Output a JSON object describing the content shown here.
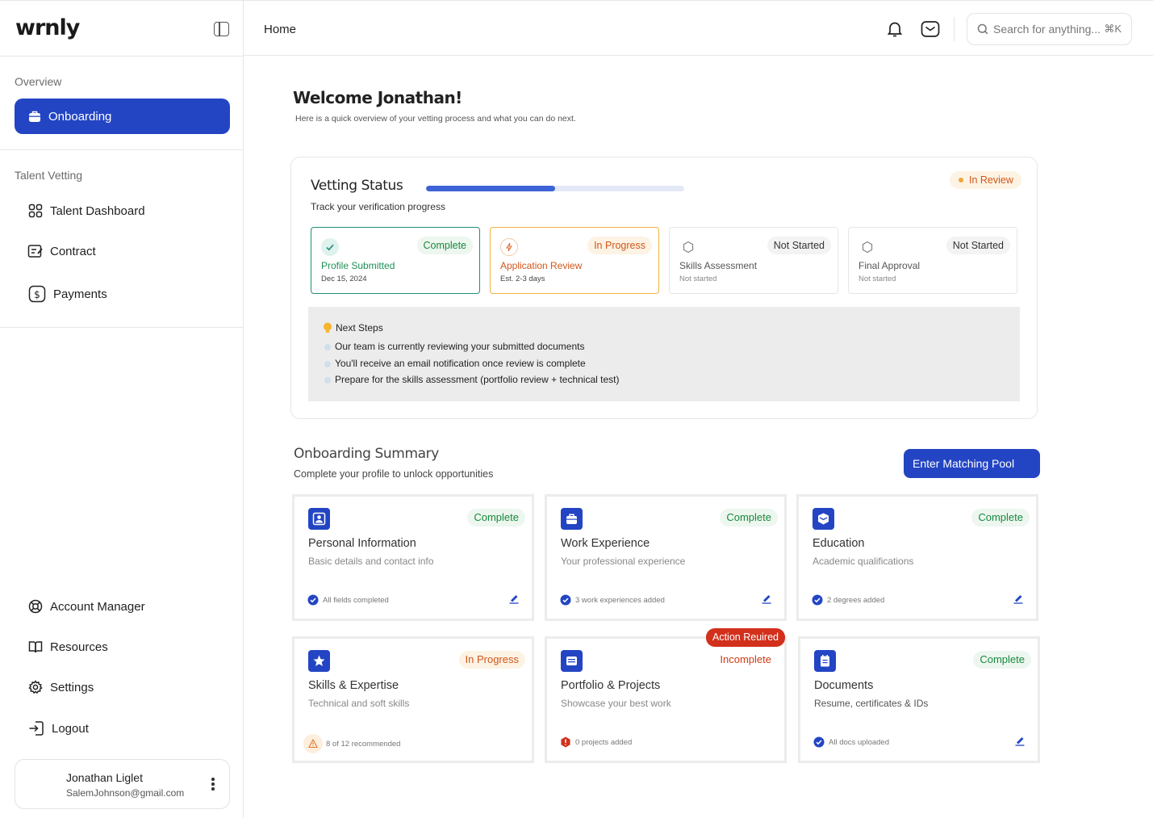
{
  "app": {
    "logo": "wrnly"
  },
  "sidebar": {
    "section_overview": "Overview",
    "active_item": "Onboarding",
    "section_talent": "Talent Vetting",
    "talent_items": [
      "Talent Dashboard",
      "Contract",
      "Payments"
    ],
    "bottom_items": [
      "Account Manager",
      "Resources",
      "Settings",
      "Logout"
    ],
    "user": {
      "name": "Jonathan Liglet",
      "email": "SalemJohnson@gmail.com"
    }
  },
  "topbar": {
    "breadcrumb": "Home",
    "search_placeholder": "Search for anything...",
    "search_shortcut": "⌘K"
  },
  "welcome": {
    "title": "Welcome Jonathan!",
    "subtitle": "Here is a quick overview of your vetting process and what you can do next."
  },
  "vetting": {
    "title": "Vetting Status",
    "subtitle": "Track your verification progress",
    "progress": 0.5,
    "status": "In Review",
    "steps": [
      {
        "name": "Profile Submitted",
        "badge": "Complete",
        "detail": "Dec 15, 2024"
      },
      {
        "name": "Application Review",
        "badge": "In Progress",
        "detail": "Est. 2-3 days"
      },
      {
        "name": "Skills Assessment",
        "badge": "Not Started",
        "detail": "Not started"
      },
      {
        "name": "Final Approval",
        "badge": "Not Started",
        "detail": "Not started"
      }
    ],
    "next_steps": {
      "title": "Next Steps",
      "items": [
        "Our team is currently reviewing your submitted documents",
        "You'll receive an email notification once review is complete",
        "Prepare for the skills assessment (portfolio review + technical test)"
      ]
    }
  },
  "summary": {
    "title": "Onboarding Summary",
    "subtitle": "Complete your profile to unlock opportunities",
    "button": "Enter Matching Pool",
    "action_required": "Action Reuired",
    "cards": [
      {
        "title": "Personal Information",
        "subtitle": "Basic details and contact info",
        "badge": "Complete",
        "footer": "All fields completed"
      },
      {
        "title": "Work Experience",
        "subtitle": "Your professional experience",
        "badge": "Complete",
        "footer": "3 work experiences added"
      },
      {
        "title": "Education",
        "subtitle": "Academic qualifications",
        "badge": "Complete",
        "footer": "2 degrees added"
      },
      {
        "title": "Skills & Expertise",
        "subtitle": "Technical and soft skills",
        "badge": "In Progress",
        "footer": "8 of 12 recommended"
      },
      {
        "title": "Portfolio & Projects",
        "subtitle": "Showcase your best work",
        "badge": "Incomplete",
        "footer": "0 projects added"
      },
      {
        "title": "Documents",
        "subtitle": "Resume, certificates & IDs",
        "badge": "Complete",
        "footer": "All docs uploaded"
      }
    ]
  },
  "colors": {
    "primary": "#2345c4",
    "success": "#178a3c",
    "warning": "#d1561a",
    "danger": "#d2301c"
  }
}
